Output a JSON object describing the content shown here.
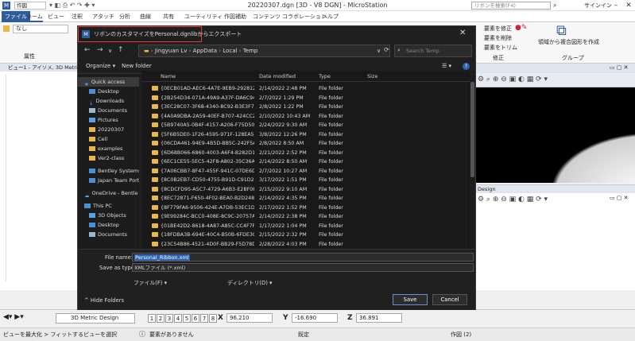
{
  "app": {
    "title": "20220307.dgn [3D - V8 DGN] - MicroStation",
    "doc_tab": "作図",
    "search_placeholder": "リボンを検索(F4)",
    "sign_in": "サインイン"
  },
  "ribbon": {
    "tabs": [
      "ファイル",
      "ホーム",
      "ビュー",
      "注釈",
      "アタッチ",
      "分析",
      "曲線",
      "共有",
      "ユーティリティ",
      "作図補助",
      "コンテンツ",
      "コラボレーション",
      "ヘルプ"
    ],
    "group_labels": [
      "修正",
      "グループ"
    ],
    "left_combo": "なし",
    "left_label": "属性",
    "right_items": [
      "要素を修正",
      "要素を削除",
      "要素をトリム"
    ],
    "right_item": "領域から複合図形を作成"
  },
  "view": {
    "left_title": "ビュー1 - アイソメ, 3D Metric Design",
    "right_title": "Design"
  },
  "dialog": {
    "title": "リボンのカスタマイズをPersonal.dgnlibからエクスポート",
    "breadcrumb": [
      "Jingyuan Lv",
      "AppData",
      "Local",
      "Temp"
    ],
    "search_placeholder": "Search Temp",
    "organize": "Organize",
    "new_folder": "New folder",
    "nav_items": [
      {
        "label": "Quick access",
        "icon": "star",
        "selected": true
      },
      {
        "label": "Desktop",
        "icon": "folder-blue"
      },
      {
        "label": "Downloads",
        "icon": "download"
      },
      {
        "label": "Documents",
        "icon": "doc"
      },
      {
        "label": "Pictures",
        "icon": "pic"
      },
      {
        "label": "20220307",
        "icon": "folder"
      },
      {
        "label": "Cell",
        "icon": "folder"
      },
      {
        "label": "examples",
        "icon": "folder"
      },
      {
        "label": "Ver2-class",
        "icon": "folder"
      },
      {
        "label": "Bentley Systems, In",
        "icon": "folder-blue"
      },
      {
        "label": "Japan Team Port",
        "icon": "folder-blue"
      },
      {
        "label": "OneDrive - Bentle",
        "icon": "cloud"
      },
      {
        "label": "This PC",
        "icon": "pc"
      },
      {
        "label": "3D Objects",
        "icon": "cube"
      },
      {
        "label": "Desktop",
        "icon": "folder-blue"
      },
      {
        "label": "Documents",
        "icon": "doc"
      }
    ],
    "columns": [
      "Name",
      "Date modified",
      "Type",
      "Size"
    ],
    "rows": [
      {
        "name": "{0ECB01AD-AEC6-4A7E-9EB9-292812D1...",
        "date": "2/14/2022 2:48 PM",
        "type": "File folder"
      },
      {
        "name": "{2B254D34-071A-49A9-A37F-DA6C9493...",
        "date": "2/7/2022 1:29 PM",
        "type": "File folder"
      },
      {
        "name": "{3EC28C07-3F68-4340-8C92-B3E3F71220...",
        "date": "2/8/2022 1:22 PM",
        "type": "File folder"
      },
      {
        "name": "{4A0A9DBA-2A59-40EF-B707-424CC2AB...",
        "date": "2/10/2022 10:43 AM",
        "type": "File folder"
      },
      {
        "name": "{5B9740A5-0B4F-4157-A206-F75D5006F...",
        "date": "2/24/2022 9:30 AM",
        "type": "File folder"
      },
      {
        "name": "{5F6B5DE0-1F26-4595-971F-128EA5DF8...",
        "date": "3/8/2022 12:26 PM",
        "type": "File folder"
      },
      {
        "name": "{06CDA461-94E9-4B5D-BB5C-242F5A45...",
        "date": "2/8/2022 8:50 AM",
        "type": "File folder"
      },
      {
        "name": "{6D68B066-6860-4003-A6F4-B282D17A7...",
        "date": "2/21/2022 2:52 PM",
        "type": "File folder"
      },
      {
        "name": "{6EC1CE55-5EC5-42F8-A802-35C36AE0D...",
        "date": "2/14/2022 8:50 AM",
        "type": "File folder"
      },
      {
        "name": "{7A06CBB7-8F47-455F-941C-07DE6D9B7...",
        "date": "2/7/2022 10:27 AM",
        "type": "File folder"
      },
      {
        "name": "{8C0B2EB7-CD50-4755-B91D-C91D2B47...",
        "date": "3/17/2022 1:51 PM",
        "type": "File folder"
      },
      {
        "name": "{8CDCFD95-A5C7-4729-A6B3-E2BF0896...",
        "date": "2/15/2022 9:10 AM",
        "type": "File folder"
      },
      {
        "name": "{8EC72871-F650-4F02-BEA0-B2D248933...",
        "date": "2/14/2022 4:35 PM",
        "type": "File folder"
      },
      {
        "name": "{8F779FA6-9506-424E-A7DB-53EC1D118...",
        "date": "2/17/2022 1:52 PM",
        "type": "File folder"
      },
      {
        "name": "{9E99284C-BCC0-408E-8C9C-20757A032...",
        "date": "2/14/2022 2:38 PM",
        "type": "File folder"
      },
      {
        "name": "{01BE42D2-8618-4A87-A85C-CC4F7F2A...",
        "date": "1/17/2022 1:04 PM",
        "type": "File folder"
      },
      {
        "name": "{18FDBA3B-694E-40C4-B50B-6FDE3C042...",
        "date": "2/15/2022 2:32 PM",
        "type": "File folder"
      },
      {
        "name": "{23C54B86-4521-4D0F-BB29-F5D78DAA...",
        "date": "2/28/2022 4:03 PM",
        "type": "File folder"
      }
    ],
    "file_name_label": "File name:",
    "file_name_value": "Personal_Ribbon.xml",
    "save_as_label": "Save as type:",
    "save_as_value": "XMLファイル (*.xml)",
    "file_dropdown": "ファイル(F)",
    "directory_dropdown": "ディレクトリ(D)",
    "save": "Save",
    "cancel": "Cancel",
    "hide_folders": "Hide Folders"
  },
  "bottom": {
    "model_select": "3D Metric Design",
    "view_numbers": [
      "1",
      "2",
      "3",
      "4",
      "5",
      "6",
      "7",
      "8"
    ],
    "x_label": "X",
    "x_value": "96.210",
    "y_label": "Y",
    "y_value": "-16.690",
    "z_label": "Z",
    "z_value": "36.891",
    "status_left": "ビューを最大化 > フィットするビューを選択",
    "status_mid": "要素がありません",
    "status_mid2": "既定",
    "status_right": "作図 (2)"
  },
  "colors": {
    "accent": "#2e5d9a",
    "dialog_bg": "#1f1f1f",
    "folder": "#e8b84a",
    "highlight_box": "#e53935",
    "selection": "#2f64b5"
  }
}
